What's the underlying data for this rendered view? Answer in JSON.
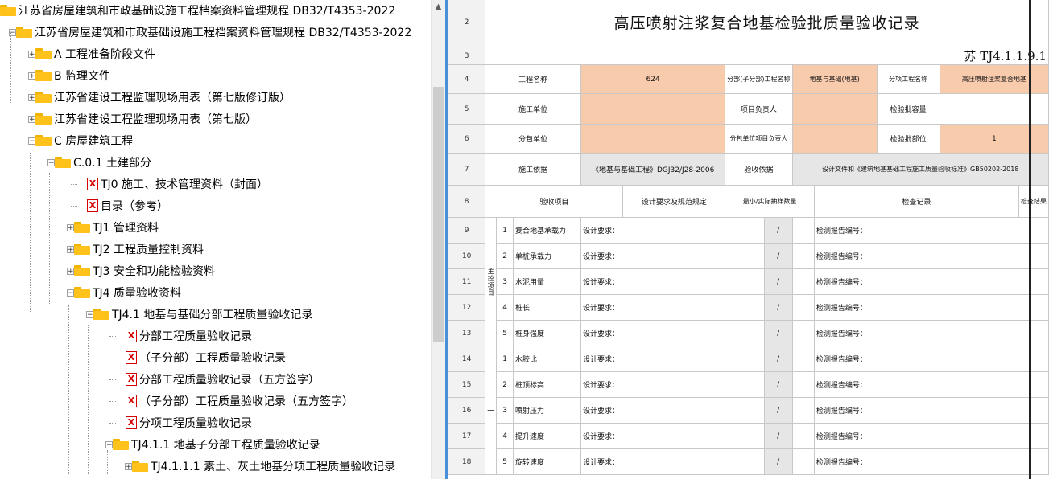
{
  "tree": {
    "items": [
      {
        "label": "江苏省房屋建筑和市政基础设施工程档案资料管理规程 DB32/T4353-2022",
        "icon": "folder-icon"
      },
      {
        "label": "江苏省房屋建筑和市政基础设施工程档案资料管理规程 DB32/T4353-2022",
        "icon": "folder-icon"
      },
      {
        "label": "A 工程准备阶段文件",
        "icon": "folder-icon"
      },
      {
        "label": "B 监理文件",
        "icon": "folder-icon"
      },
      {
        "label": "江苏省建设工程监理现场用表（第七版修订版）",
        "icon": "folder-icon"
      },
      {
        "label": "江苏省建设工程监理现场用表（第七版）",
        "icon": "folder-icon"
      },
      {
        "label": "C 房屋建筑工程",
        "icon": "folder-icon"
      },
      {
        "label": "C.0.1 土建部分",
        "icon": "folder-icon"
      },
      {
        "label": "TJ0 施工、技术管理资料（封面）",
        "icon": "excel-file-icon"
      },
      {
        "label": "目录（参考）",
        "icon": "excel-file-icon"
      },
      {
        "label": "TJ1 管理资料",
        "icon": "folder-icon"
      },
      {
        "label": "TJ2 工程质量控制资料",
        "icon": "folder-icon"
      },
      {
        "label": "TJ3 安全和功能检验资料",
        "icon": "folder-icon"
      },
      {
        "label": "TJ4 质量验收资料",
        "icon": "folder-icon"
      },
      {
        "label": "TJ4.1 地基与基础分部工程质量验收记录",
        "icon": "folder-icon"
      },
      {
        "label": "分部工程质量验收记录",
        "icon": "excel-file-icon"
      },
      {
        "label": "（子分部）工程质量验收记录",
        "icon": "excel-file-icon"
      },
      {
        "label": "分部工程质量验收记录（五方签字）",
        "icon": "excel-file-icon"
      },
      {
        "label": "（子分部）工程质量验收记录（五方签字）",
        "icon": "excel-file-icon"
      },
      {
        "label": "分项工程质量验收记录",
        "icon": "excel-file-icon"
      },
      {
        "label": "TJ4.1.1 地基子分部工程质量验收记录",
        "icon": "folder-icon"
      },
      {
        "label": "TJ4.1.1.1 素土、灰土地基分项工程质量验收记录",
        "icon": "folder-icon"
      }
    ],
    "file_glyph": "X",
    "plus": "+",
    "minus": "−"
  },
  "scrollbar": {
    "up_arrow": "▲"
  },
  "sheet": {
    "row_numbers": [
      "2",
      "3",
      "4",
      "5",
      "6",
      "7",
      "8",
      "9",
      "10",
      "11",
      "12",
      "13",
      "14",
      "15",
      "16",
      "17",
      "18"
    ],
    "title": "高压喷射注浆复合地基检验批质量验收记录",
    "code": "苏 TJ4.1.1.9.1",
    "r4": {
      "a": "工程名称",
      "b": "624",
      "c": "分部(子分部)工程名称",
      "d": "地基与基础(地基)",
      "e": "分项工程名称",
      "f": "高压喷射注浆复合地基"
    },
    "r5": {
      "a": "施工单位",
      "c": "项目负责人",
      "e": "检验批容量"
    },
    "r6": {
      "a": "分包单位",
      "c": "分包单位项目负责人",
      "e": "检验批部位",
      "f": "1"
    },
    "r7": {
      "a": "施工依据",
      "b": "《地基与基础工程》DGJ32/J28-2006",
      "c": "验收依据",
      "d": "设计文件和《建筑地基基础工程施工质量验收标准》GB50202-2018"
    },
    "r8": {
      "a": "验收项目",
      "b": "设计要求及规范规定",
      "c": "最小/实际抽样数量",
      "d": "检查记录",
      "e": "检查结果"
    },
    "main_group": "主控项目",
    "general_group": "一",
    "items": [
      {
        "n": "1",
        "name": "复合地基承载力",
        "req": "设计要求：",
        "slash": "/",
        "rec": "检测报告编号："
      },
      {
        "n": "2",
        "name": "单桩承载力",
        "req": "设计要求：",
        "slash": "/",
        "rec": "检测报告编号："
      },
      {
        "n": "3",
        "name": "水泥用量",
        "req": "设计要求：",
        "slash": "/",
        "rec": "检测报告编号："
      },
      {
        "n": "4",
        "name": "桩长",
        "req": "设计要求：",
        "slash": "/",
        "rec": "检测报告编号："
      },
      {
        "n": "5",
        "name": "桩身强度",
        "req": "设计要求：",
        "slash": "/",
        "rec": "检测报告编号："
      },
      {
        "n": "1",
        "name": "水胶比",
        "req": "设计要求：",
        "slash": "/",
        "rec": "检测报告编号："
      },
      {
        "n": "2",
        "name": "桩顶标高",
        "req": "设计要求：",
        "slash": "/",
        "rec": "检测报告编号："
      },
      {
        "n": "3",
        "name": "喷射压力",
        "req": "设计要求：",
        "slash": "/",
        "rec": "检测报告编号："
      },
      {
        "n": "4",
        "name": "提升速度",
        "req": "设计要求：",
        "slash": "/",
        "rec": "检测报告编号："
      },
      {
        "n": "5",
        "name": "旋转速度",
        "req": "设计要求：",
        "slash": "/",
        "rec": "检测报告编号："
      }
    ]
  }
}
